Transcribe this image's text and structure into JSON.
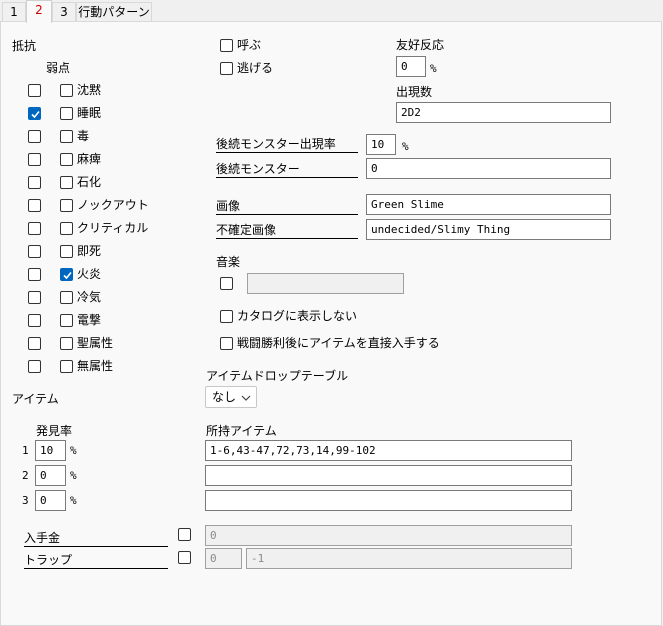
{
  "tabs": [
    "1",
    "2",
    "3",
    "行動パターン"
  ],
  "resistance": {
    "title": "抵抗",
    "weakness_header": "弱点",
    "items": [
      {
        "label": "沈黙",
        "resist": false,
        "weak": false
      },
      {
        "label": "睡眠",
        "resist": true,
        "weak": false
      },
      {
        "label": "毒",
        "resist": false,
        "weak": false
      },
      {
        "label": "麻痺",
        "resist": false,
        "weak": false
      },
      {
        "label": "石化",
        "resist": false,
        "weak": false
      },
      {
        "label": "ノックアウト",
        "resist": false,
        "weak": false
      },
      {
        "label": "クリティカル",
        "resist": false,
        "weak": false
      },
      {
        "label": "即死",
        "resist": false,
        "weak": false
      },
      {
        "label": "火炎",
        "resist": false,
        "weak": true
      },
      {
        "label": "冷気",
        "resist": false,
        "weak": false
      },
      {
        "label": "電撃",
        "resist": false,
        "weak": false
      },
      {
        "label": "聖属性",
        "resist": false,
        "weak": false
      },
      {
        "label": "無属性",
        "resist": false,
        "weak": false
      }
    ]
  },
  "call": {
    "label": "呼ぶ",
    "checked": false
  },
  "flee": {
    "label": "逃げる",
    "checked": false
  },
  "friendly": {
    "label": "友好反応",
    "value": "0",
    "unit": "%"
  },
  "appear_count": {
    "label": "出現数",
    "value": "2D2"
  },
  "follow_rate": {
    "label": "後続モンスター出現率",
    "value": "10",
    "unit": "%"
  },
  "follow_monster": {
    "label": "後続モンスター",
    "value": "0"
  },
  "image": {
    "label": "画像",
    "value": "Green Slime"
  },
  "uncertain_image": {
    "label": "不確定画像",
    "value": "undecided/Slimy Thing"
  },
  "music": {
    "label": "音楽",
    "checked": false,
    "value": ""
  },
  "hide_catalog": {
    "label": "カタログに表示しない",
    "checked": false
  },
  "direct_item": {
    "label": "戦闘勝利後にアイテムを直接入手する",
    "checked": false
  },
  "drop_table": {
    "label": "アイテムドロップテーブル",
    "value": "なし"
  },
  "items": {
    "title": "アイテム",
    "rate_header": "発見率",
    "held_header": "所持アイテム",
    "rows": [
      {
        "num": "1",
        "rate": "10",
        "unit": "%",
        "held": "1-6,43-47,72,73,14,99-102"
      },
      {
        "num": "2",
        "rate": "0",
        "unit": "%",
        "held": ""
      },
      {
        "num": "3",
        "rate": "0",
        "unit": "%",
        "held": ""
      }
    ]
  },
  "gold": {
    "label": "入手金",
    "checked": false,
    "value": "0"
  },
  "trap": {
    "label": "トラップ",
    "checked": false,
    "value1": "0",
    "value2": "-1"
  }
}
